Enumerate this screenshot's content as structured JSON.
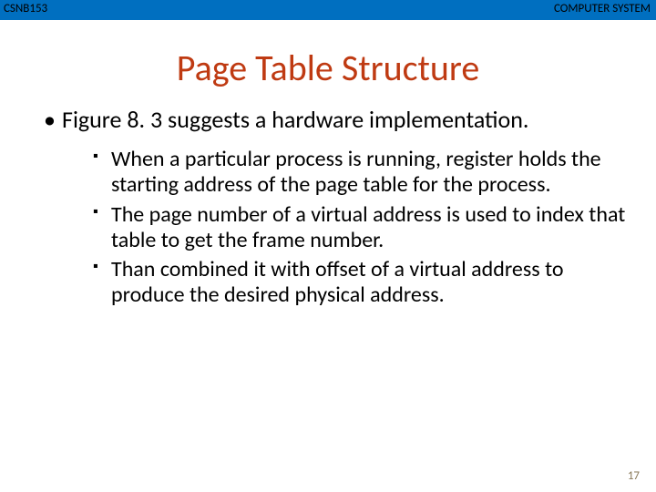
{
  "header": {
    "left": "CSNB153",
    "right": "COMPUTER SYSTEM"
  },
  "title": "Page Table Structure",
  "bullets": {
    "main": "Figure 8. 3 suggests a hardware implementation.",
    "sub1": "When a particular process is running, register holds the starting address of the page table for the process.",
    "sub2": "The page number of a virtual address is used to index that table to get the frame number.",
    "sub3": "Than combined it with offset of a virtual address to produce the desired physical address."
  },
  "page_number": "17"
}
